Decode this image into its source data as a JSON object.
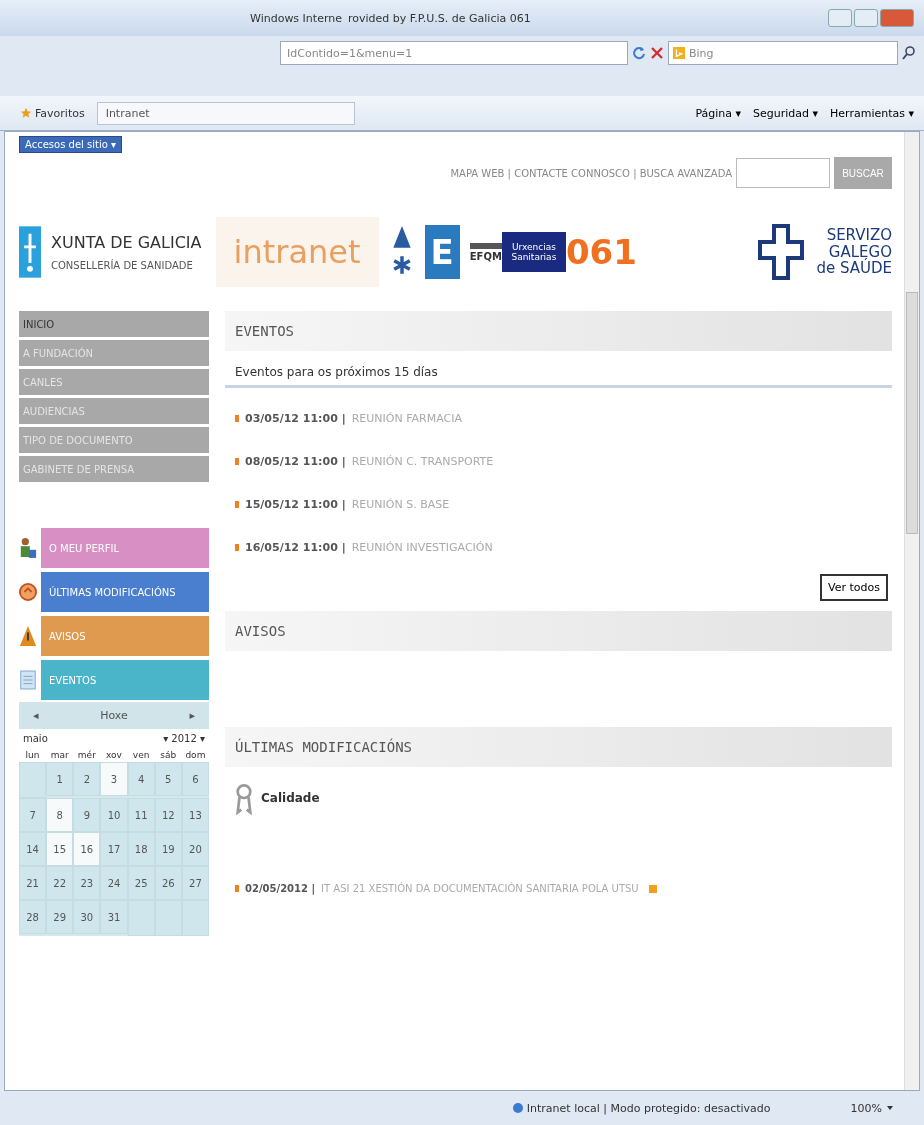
{
  "window": {
    "title_fragments": [
      "Windows Interne",
      "rovided by F.P.U.S. de Galicia 061"
    ]
  },
  "address_bar": {
    "url_fragment": "IdContido=1&menu=1",
    "search_engine": "Bing"
  },
  "favorites_bar": {
    "favorites": "Favoritos",
    "tab": "Intranet"
  },
  "command_bar": [
    "Página ▾",
    "Seguridad ▾",
    "Herramientas ▾"
  ],
  "site_access": "Accesos del sitio ▾",
  "top_links": "MAPA WEB | CONTACTE CONNOSCO | BUSCA AVANZADA",
  "search_button": "BUSCAR",
  "header": {
    "org": "XUNTA DE GALICIA",
    "dept": "CONSELLERÍA DE SANIDADE",
    "intranet": "intranet",
    "e_logo": "E",
    "efqm": "EFQM",
    "urxencias": "Urxencias Sanitarias",
    "number": "061",
    "sergas": [
      "SERVIZO",
      "GALEGO",
      "de SAÚDE"
    ]
  },
  "nav": [
    {
      "label": "INICIO",
      "selected": true
    },
    {
      "label": "A FUNDACIÓN",
      "selected": false
    },
    {
      "label": "CANLES",
      "selected": false
    },
    {
      "label": "AUDIENCIAS",
      "selected": false
    },
    {
      "label": "TIPO DE DOCUMENTO",
      "selected": false
    },
    {
      "label": "GABINETE DE PRENSA",
      "selected": false
    }
  ],
  "shortcuts": [
    {
      "label": "O MEU PERFIL",
      "kind": "profile",
      "color": "#d890c4"
    },
    {
      "label": "ÚLTIMAS MODIFICACIÓNS",
      "kind": "updates",
      "color": "#4a7fd0"
    },
    {
      "label": "AVISOS",
      "kind": "warning",
      "color": "#e09a50"
    },
    {
      "label": "EVENTOS",
      "kind": "calendar",
      "color": "#4ab4c8"
    }
  ],
  "calendar": {
    "prev": "◂",
    "today": "Hoxe",
    "next": "▸",
    "month": "maio",
    "year": "▾ 2012 ▾",
    "weekdays": [
      "lun",
      "mar",
      "mér",
      "xov",
      "ven",
      "sáb",
      "dom"
    ],
    "weeks": [
      [
        {
          "kind": "blank"
        },
        {
          "d": "1",
          "event": false
        },
        {
          "d": "2",
          "event": false
        },
        {
          "d": "3",
          "event": true
        },
        {
          "d": "4",
          "event": false
        },
        {
          "d": "5",
          "event": false
        },
        {
          "d": "6",
          "event": false
        }
      ],
      [
        {
          "d": "7",
          "event": false
        },
        {
          "d": "8",
          "event": true
        },
        {
          "d": "9",
          "event": false
        },
        {
          "d": "10",
          "event": false
        },
        {
          "d": "11",
          "event": false
        },
        {
          "d": "12",
          "event": false
        },
        {
          "d": "13",
          "event": false
        }
      ],
      [
        {
          "d": "14",
          "event": false
        },
        {
          "d": "15",
          "event": true
        },
        {
          "d": "16",
          "event": true
        },
        {
          "d": "17",
          "event": false
        },
        {
          "d": "18",
          "event": false
        },
        {
          "d": "19",
          "event": false
        },
        {
          "d": "20",
          "event": false
        }
      ],
      [
        {
          "d": "21",
          "event": false
        },
        {
          "d": "22",
          "event": false
        },
        {
          "d": "23",
          "event": false
        },
        {
          "d": "24",
          "event": false
        },
        {
          "d": "25",
          "event": false
        },
        {
          "d": "26",
          "event": false
        },
        {
          "d": "27",
          "event": false
        }
      ],
      [
        {
          "d": "28",
          "event": false
        },
        {
          "d": "29",
          "event": false
        },
        {
          "d": "30",
          "event": false
        },
        {
          "d": "31",
          "event": false
        },
        {
          "kind": "blank"
        },
        {
          "kind": "blank"
        },
        {
          "kind": "blank"
        }
      ]
    ]
  },
  "events": {
    "title": "EVENTOS",
    "subtitle": "Eventos para os próximos 15 días",
    "items": [
      {
        "date": "03/05/12 11:00 |",
        "name": "REUNIÓN FARMACIA"
      },
      {
        "date": "08/05/12 11:00 |",
        "name": "REUNIÓN C. TRANSPORTE"
      },
      {
        "date": "15/05/12 11:00 |",
        "name": "REUNIÓN S. BASE"
      },
      {
        "date": "16/05/12 11:00 |",
        "name": "REUNIÓN INVESTIGACIÓN"
      }
    ],
    "more": "Ver todos"
  },
  "notices": {
    "title": "AVISOS"
  },
  "updates": {
    "title": "ÚLTIMAS MODIFICACIÓNS",
    "category": "Calidade",
    "items": [
      {
        "date": "02/05/2012 |",
        "name": "IT ASI 21 XESTIÓN DA DOCUMENTACIÓN SANITARIA POLA UTSU"
      }
    ]
  },
  "status_bar": {
    "zone": "Intranet local | Modo protegido: desactivado",
    "zoom": "100%"
  }
}
